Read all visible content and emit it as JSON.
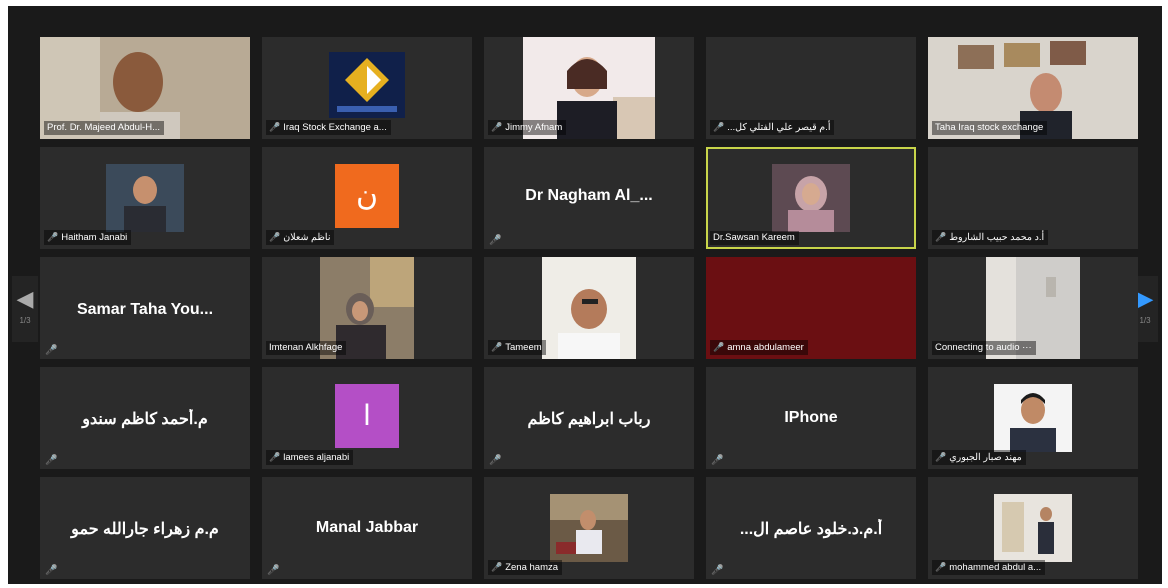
{
  "navigation": {
    "left_page": "1/3",
    "right_page": "1/3",
    "left_arrow": "◀",
    "right_arrow": "▶"
  },
  "participants": [
    {
      "label": "Prof. Dr. Majeed Abdul-H...",
      "muted": false
    },
    {
      "label": "Iraq Stock Exchange a...",
      "muted": true
    },
    {
      "label": "Jimmy Afnam",
      "muted": true
    },
    {
      "label": "...أ.م قيصر علي الفتلي كل",
      "muted": true
    },
    {
      "label": "Taha Iraq stock exchange",
      "muted": false
    },
    {
      "label": "Haitham Janabi",
      "muted": true
    },
    {
      "label": "ناظم شعلان",
      "muted": true,
      "avatar": "ن"
    },
    {
      "display": "Dr Nagham Al_...",
      "muted": true
    },
    {
      "label": "Dr.Sawsan Kareem",
      "muted": false
    },
    {
      "label": "أ.د محمد حبيب الشاروط",
      "muted": true
    },
    {
      "display": "Samar Taha You...",
      "muted": true
    },
    {
      "label": "Imtenan Alkhfage",
      "muted": false
    },
    {
      "label": "Tameem",
      "muted": true
    },
    {
      "label": "amna abdulameer",
      "muted": true
    },
    {
      "label": "Connecting to audio ···",
      "muted": false
    },
    {
      "display": "م.أحمد كاظم سندو",
      "muted": true
    },
    {
      "label": "lamees aljanabi",
      "muted": true,
      "avatar": "l"
    },
    {
      "display": "رباب ابراهيم كاظم",
      "muted": true
    },
    {
      "display": "IPhone",
      "muted": true
    },
    {
      "label": "مهند صبار الجبوري",
      "muted": true
    },
    {
      "display": "م.م زهراء جارالله حمو",
      "muted": true
    },
    {
      "display": "Manal Jabbar",
      "muted": true
    },
    {
      "label": "Zena hamza",
      "muted": true
    },
    {
      "display": "...أ.م.د.خلود عاصم ال",
      "muted": true
    },
    {
      "label": "mohammed abdul a...",
      "muted": true
    }
  ],
  "colors": {
    "background": "#1a1a1a",
    "tile": "#2c2c2c",
    "active_border": "#c8d54a",
    "muted_icon": "#e05040",
    "nav_arrow": "#3399ff",
    "avatar_orange": "#f06a1e",
    "avatar_purple": "#b44fc6",
    "amna_video": "#6b0f12"
  },
  "icons": {
    "muted_icon": "🎤"
  }
}
